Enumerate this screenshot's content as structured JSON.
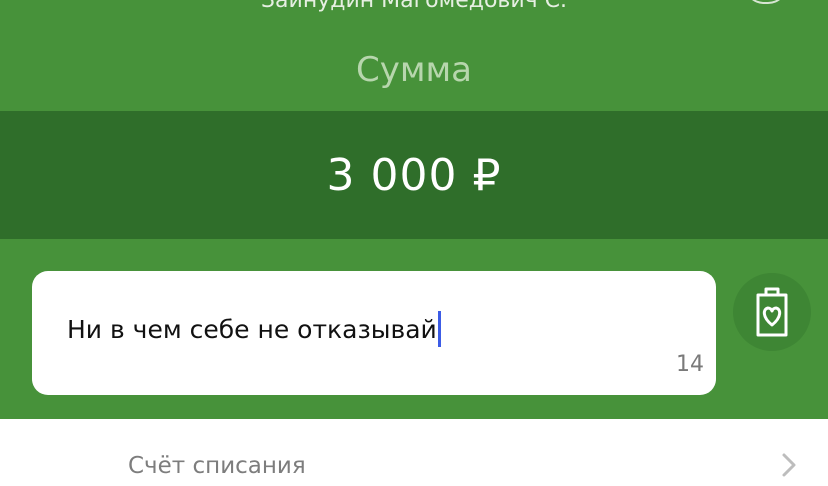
{
  "header": {
    "recipient_name": "Зайнудин Магомедович С."
  },
  "amount": {
    "label": "Сумма",
    "value": "3 000 ₽"
  },
  "message": {
    "text": "Ни в чем себе не отказывай",
    "char_count": "14"
  },
  "account": {
    "label": "Счёт списания"
  },
  "icons": {
    "gift_card": "gift-card-icon",
    "chevron": "chevron-right-icon"
  },
  "colors": {
    "primary_green": "#47923a",
    "dark_green": "#2f6e2a",
    "caret": "#3c5ce6"
  }
}
